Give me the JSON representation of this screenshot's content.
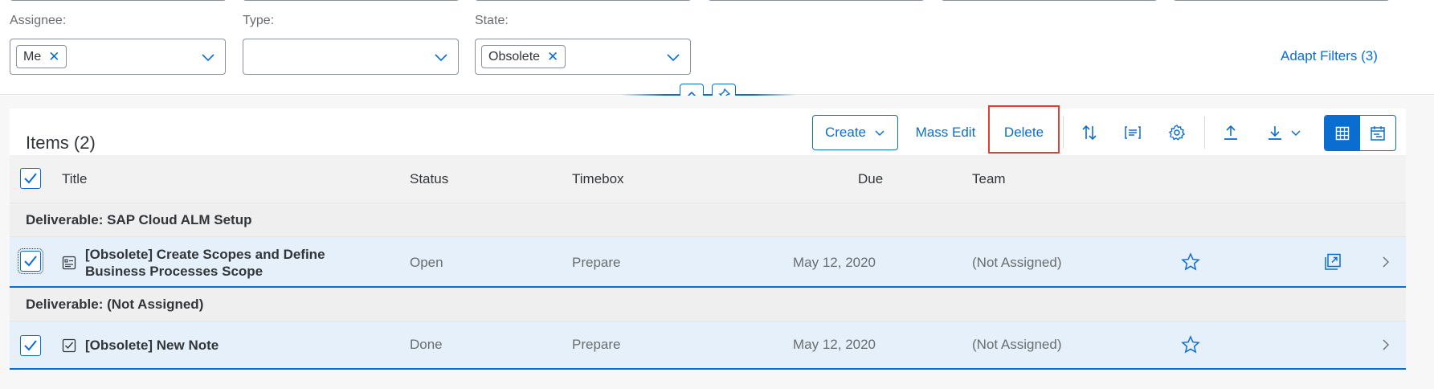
{
  "filters": {
    "assignee": {
      "label": "Assignee:",
      "token": "Me"
    },
    "type": {
      "label": "Type:"
    },
    "state": {
      "label": "State:",
      "token": "Obsolete"
    },
    "adapt_filters": "Adapt Filters (3)"
  },
  "toolbar": {
    "title": "Items (2)",
    "create": "Create",
    "mass_edit": "Mass Edit",
    "delete": "Delete"
  },
  "columns": [
    "Title",
    "Status",
    "Timebox",
    "Due",
    "Team"
  ],
  "groups": [
    {
      "label": "Deliverable: SAP Cloud ALM Setup",
      "row": {
        "title_line1": "[Obsolete] Create Scopes and Define",
        "title_line2": "Business Processes Scope",
        "status": "Open",
        "timebox": "Prepare",
        "due": "May 12, 2020",
        "team": "(Not Assigned)",
        "type_icon": "task-list-icon"
      }
    },
    {
      "label": "Deliverable: (Not Assigned)",
      "row": {
        "title": "[Obsolete] New Note",
        "status": "Done",
        "timebox": "Prepare",
        "due": "May 12, 2020",
        "team": "(Not Assigned)",
        "type_icon": "checklist-icon"
      }
    }
  ],
  "colors": {
    "accent": "#0a6ed1",
    "highlight": "#e0403a",
    "selected_row": "#e5f0fa"
  }
}
